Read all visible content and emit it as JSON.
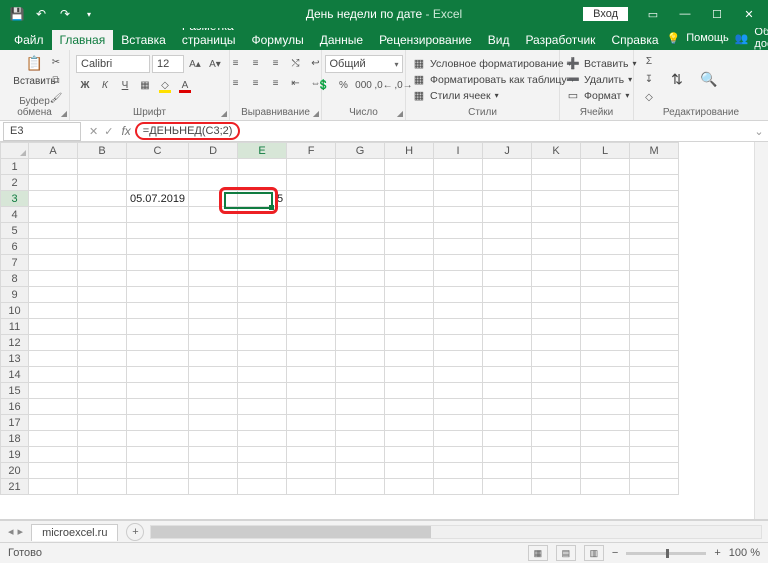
{
  "title": {
    "doc": "День недели по дате",
    "app": "Excel"
  },
  "login": "Вход",
  "tabs": {
    "file": "Файл",
    "home": "Главная",
    "insert": "Вставка",
    "layout": "Разметка страницы",
    "formulas": "Формулы",
    "data": "Данные",
    "review": "Рецензирование",
    "view": "Вид",
    "developer": "Разработчик",
    "help": "Справка",
    "tellme": "Помощь",
    "share": "Общий доступ"
  },
  "ribbon": {
    "clipboard": {
      "label": "Буфер обмена",
      "paste": "Вставить"
    },
    "font": {
      "label": "Шрифт",
      "name": "Calibri",
      "size": "12"
    },
    "align": {
      "label": "Выравнивание"
    },
    "number": {
      "label": "Число",
      "format": "Общий"
    },
    "styles": {
      "label": "Стили",
      "cond": "Условное форматирование",
      "table": "Форматировать как таблицу",
      "cell": "Стили ячеек"
    },
    "cells": {
      "label": "Ячейки",
      "insert": "Вставить",
      "delete": "Удалить",
      "format": "Формат"
    },
    "editing": {
      "label": "Редактирование"
    }
  },
  "namebox": "E3",
  "formula": "=ДЕНЬНЕД(C3;2)",
  "columns": [
    "A",
    "B",
    "C",
    "D",
    "E",
    "F",
    "G",
    "H",
    "I",
    "J",
    "K",
    "L",
    "M"
  ],
  "rows": 21,
  "cells": {
    "C3": "05.07.2019",
    "E3": "5"
  },
  "sheet": {
    "name": "microexcel.ru"
  },
  "status": {
    "ready": "Готово",
    "zoom": "100 %"
  }
}
